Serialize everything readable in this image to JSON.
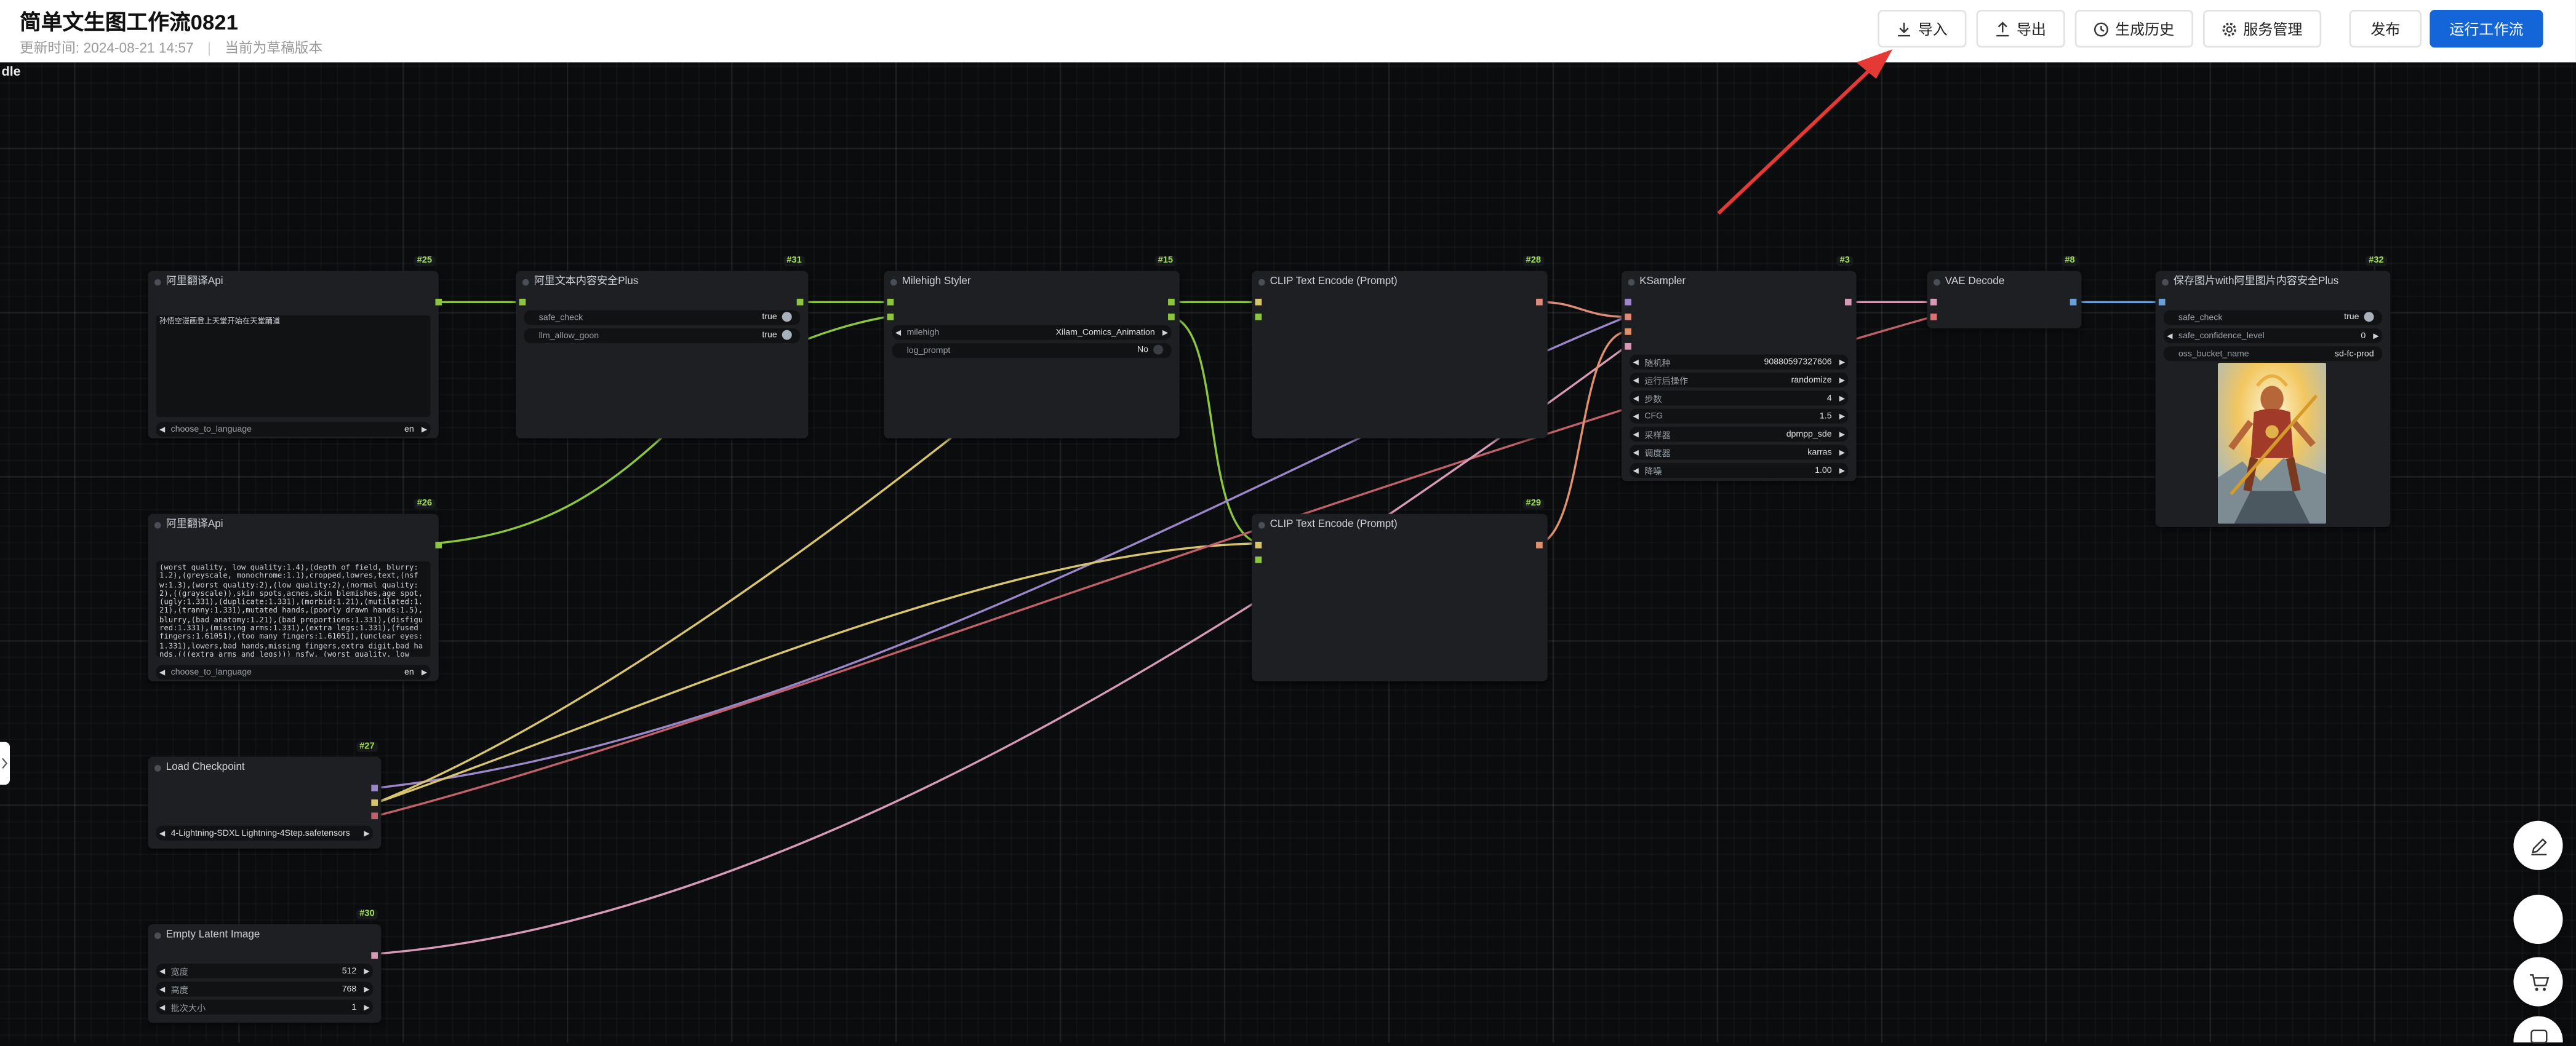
{
  "header": {
    "title": "简单文生图工作流0821",
    "updated_label": "更新时间:",
    "updated_time": "2024-08-21 14:57",
    "version_status": "当前为草稿版本",
    "buttons": {
      "import": "导入",
      "export": "导出",
      "history": "生成历史",
      "service": "服务管理",
      "publish": "发布",
      "run": "运行工作流"
    }
  },
  "canvas": {
    "status": "dle"
  },
  "colors": {
    "accent": "#1466d8",
    "arrow": "#e53935",
    "link_green": "#8cc63f",
    "link_yellow": "#d8c46c",
    "link_purple": "#9a86c8",
    "link_red": "#c0606a",
    "link_latent": "#d79ab6",
    "link_vae": "#e07070",
    "link_image": "#6aa0d8",
    "node_id": "#9fe04f"
  },
  "nodes": {
    "n25": {
      "id": "#25",
      "title": "阿里翻译Api",
      "text": "孙悟空漫画登上天堂开始在天堂踊道",
      "lang_label": "choose_to_language",
      "lang_value": "en"
    },
    "n26": {
      "id": "#26",
      "title": "阿里翻译Api",
      "text": "(worst quality, low quality:1.4),(depth of field, blurry:1.2),(greyscale, monochrome:1.1),cropped,lowres,text,(nsfw:1.3),(worst quality:2),(low quality:2),(normal quality:2),((grayscale)),skin spots,acnes,skin blemishes,age spot,(ugly:1.331),(duplicate:1.331),(morbid:1.21),(mutilated:1.21),(tranny:1.331),mutated hands,(poorly drawn hands:1.5),blurry,(bad anatomy:1.21),(bad proportions:1.331),(disfigured:1.331),(missing arms:1.331),(extra legs:1.331),(fused fingers:1.61051),(too many fingers:1.61051),(unclear eyes:1.331),lowers,bad hands,missing fingers,extra digit,bad hands,(((extra arms and legs))) nsfw, (worst quality, low",
      "lang_label": "choose_to_language",
      "lang_value": "en"
    },
    "n31": {
      "id": "#31",
      "title": "阿里文本内容安全Plus",
      "w1_label": "safe_check",
      "w1_value": "true",
      "w2_label": "llm_allow_goon",
      "w2_value": "true"
    },
    "n15": {
      "id": "#15",
      "title": "Milehigh Styler",
      "w1_label": "milehigh",
      "w1_value": "Xilam_Comics_Animation",
      "w2_label": "log_prompt",
      "w2_value": "No"
    },
    "n28": {
      "id": "#28",
      "title": "CLIP Text Encode (Prompt)"
    },
    "n29": {
      "id": "#29",
      "title": "CLIP Text Encode (Prompt)"
    },
    "n3": {
      "id": "#3",
      "title": "KSampler",
      "rows": [
        {
          "label": "随机种",
          "value": "908805973276​06"
        },
        {
          "label": "运行后操作",
          "value": "randomize"
        },
        {
          "label": "步数",
          "value": "4"
        },
        {
          "label": "CFG",
          "value": "1.5"
        },
        {
          "label": "采样器",
          "value": "dpmpp_sde"
        },
        {
          "label": "调度器",
          "value": "karras"
        },
        {
          "label": "降噪",
          "value": "1.00"
        }
      ]
    },
    "n8": {
      "id": "#8",
      "title": "VAE Decode"
    },
    "n32": {
      "id": "#32",
      "title": "保存图片with阿里图片内容安全Plus",
      "w1_label": "safe_check",
      "w1_value": "true",
      "w2_label": "safe_confidence_level",
      "w2_value": "0",
      "w3_label": "oss_bucket_name",
      "w3_value": "sd-fc-prod"
    },
    "n27": {
      "id": "#27",
      "title": "Load Checkpoint",
      "ckpt": "4-Lightning-SDXL Lightning-4Step.safetensors"
    },
    "n30": {
      "id": "#30",
      "title": "Empty Latent Image",
      "rows": [
        {
          "label": "宽度",
          "value": "512"
        },
        {
          "label": "高度",
          "value": "768"
        },
        {
          "label": "批次大小",
          "value": "1"
        }
      ]
    }
  }
}
